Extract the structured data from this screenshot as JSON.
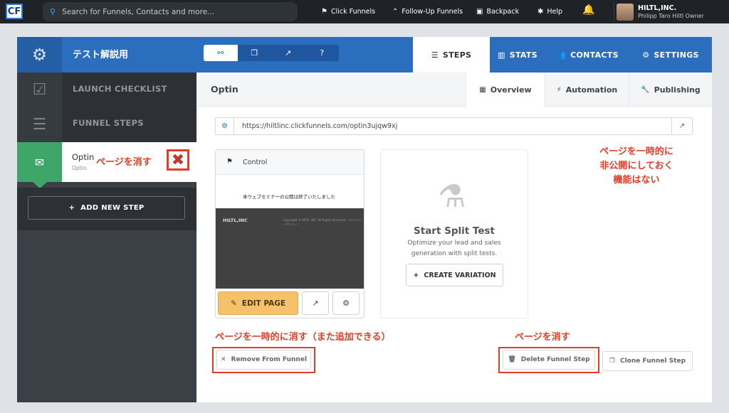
{
  "topbar": {
    "logo_text": "CF",
    "search_placeholder": "Search for Funnels, Contacts and more...",
    "nav": [
      {
        "label": "Click Funnels",
        "icon": "cf-icon",
        "glyph": "⚑"
      },
      {
        "label": "Follow-Up Funnels",
        "icon": "followup-icon",
        "glyph": "⌃"
      },
      {
        "label": "Backpack",
        "icon": "backpack-icon",
        "glyph": "▣"
      },
      {
        "label": "Help",
        "icon": "help-icon",
        "glyph": "✱"
      }
    ],
    "bell_glyph": "🔔",
    "user": {
      "name": "HILTL,INC.",
      "sub": "Philipp Taro Hiltl   Owner"
    }
  },
  "header": {
    "gear_glyph": "⚙",
    "funnel_title": "テスト解説用",
    "icon_tools": [
      {
        "icon": "link-icon",
        "glyph": "⚯"
      },
      {
        "icon": "copy-icon",
        "glyph": "❐"
      },
      {
        "icon": "external-link-icon",
        "glyph": "↗"
      },
      {
        "icon": "question-icon",
        "glyph": "?"
      }
    ],
    "tabs": [
      {
        "label": "STEPS",
        "glyph": "☰"
      },
      {
        "label": "STATS",
        "glyph": "▥"
      },
      {
        "label": "CONTACTS",
        "glyph": "👥"
      },
      {
        "label": "SETTINGS",
        "glyph": "⚙"
      }
    ]
  },
  "sidebar": {
    "launch_checklist": {
      "label": "LAUNCH CHECKLIST",
      "glyph": "☑"
    },
    "funnel_steps": {
      "label": "FUNNEL STEPS",
      "glyph": "☰"
    },
    "step": {
      "name": "Optin",
      "sub": "Optin",
      "glyph": "✉"
    },
    "add_step": {
      "label": "ADD NEW STEP",
      "glyph": "+"
    }
  },
  "content": {
    "title": "Optin",
    "subtabs": [
      {
        "label": "Overview",
        "glyph": "▦"
      },
      {
        "label": "Automation",
        "glyph": "⚡"
      },
      {
        "label": "Publishing",
        "glyph": "🔧"
      }
    ],
    "url": {
      "gear_glyph": "⚙",
      "value": "https://hiltlinc.clickfunnels.com/optin3ujqw9xj",
      "ext_glyph": "↗"
    },
    "control": {
      "flag_glyph": "⚑",
      "label": "Control",
      "thumb_text": "本ウェブセミナーの公開は終了いたしました",
      "thumb_brand": "HILTL,INC",
      "thumb_copyright": "Copyright © HILTL, INC.  All Rights Reserved.  プライバシーポリシー",
      "edit_label": "EDIT PAGE",
      "edit_glyph": "✎",
      "ext_glyph": "↗",
      "gear_glyph": "⚙"
    },
    "split": {
      "flask_glyph": "⚗",
      "title": "Start Split Test",
      "desc": "Optimize your lead and sales generation with split tests.",
      "button": "CREATE VARIATION",
      "button_glyph": "+"
    },
    "footer": {
      "remove": {
        "label": "Remove From Funnel",
        "glyph": "✕"
      },
      "delete": {
        "label": "Delete Funnel Step",
        "glyph": "🗑"
      },
      "clone": {
        "label": "Clone Funnel Step",
        "glyph": "❐"
      }
    }
  },
  "annotations": {
    "delete_page": "ページを消す",
    "x_glyph": "✖",
    "no_unpublish_1": "ページを一時的に",
    "no_unpublish_2": "非公開にしておく",
    "no_unpublish_3": "機能はない",
    "temp_remove": "ページを一時的に消す（また追加できる）",
    "delete_page2": "ページを消す"
  },
  "colors": {
    "header_blue": "#2a6ebd",
    "step_green": "#3fa66a",
    "annotation_red": "#e23d26",
    "edit_yellow": "#f5c16b"
  }
}
